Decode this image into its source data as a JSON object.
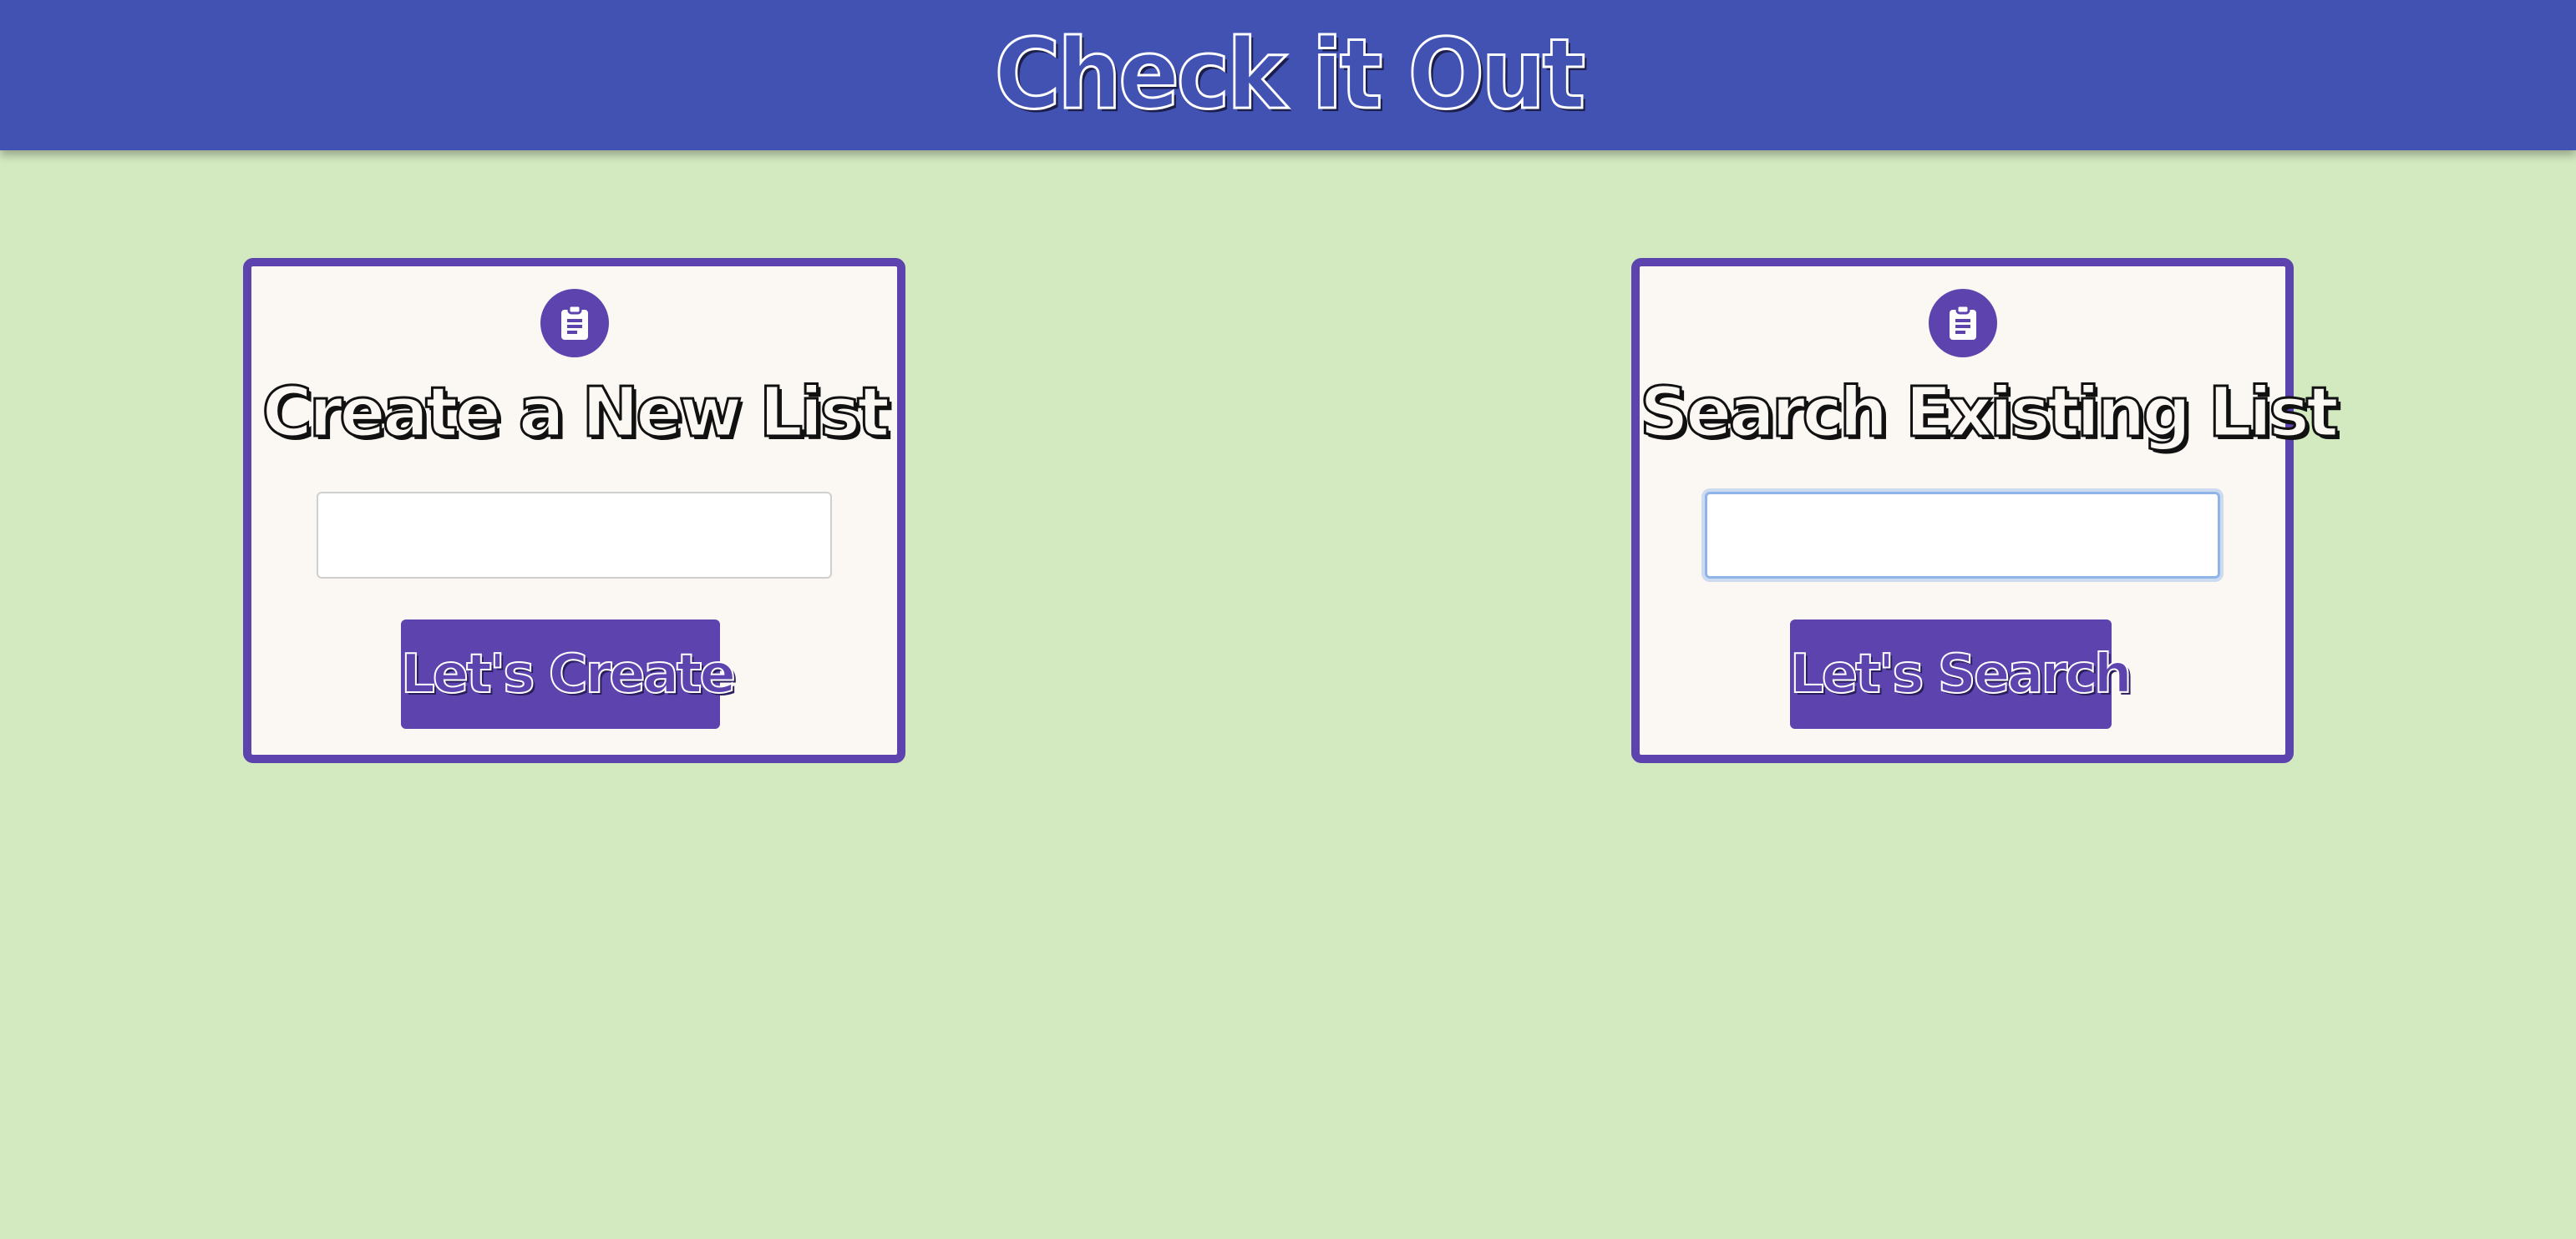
{
  "header": {
    "title": "Check it Out"
  },
  "create_card": {
    "icon": "clipboard-icon",
    "title": "Create a New List",
    "input_value": "",
    "button_label": "Let's Create"
  },
  "search_card": {
    "icon": "clipboard-icon",
    "title": "Search Existing List",
    "input_value": "",
    "input_focused": true,
    "button_label": "Let's Search"
  },
  "colors": {
    "header_background": "#4152b3",
    "page_background": "#d3e9c0",
    "card_border": "#5d43ae",
    "card_background": "#fbf8f4",
    "button_background": "#5d43ae"
  }
}
